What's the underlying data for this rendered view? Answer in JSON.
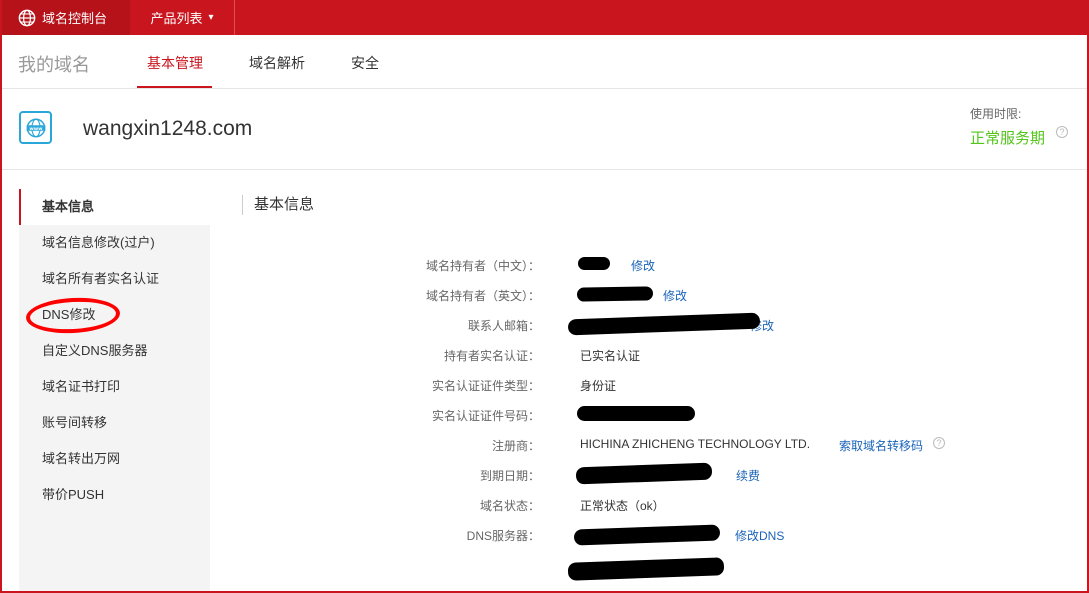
{
  "topbar": {
    "brand_label": "域名控制台",
    "menu_label": "产品列表",
    "menu_caret": "▾"
  },
  "nav": {
    "title": "我的域名",
    "tabs": [
      {
        "label": "基本管理",
        "active": true
      },
      {
        "label": "域名解析",
        "active": false
      },
      {
        "label": "安全",
        "active": false
      }
    ]
  },
  "domain": {
    "name": "wangxin1248.com",
    "usage_label": "使用时限:",
    "usage_status": "正常服务期"
  },
  "sidebar": {
    "items": [
      {
        "label": "基本信息",
        "active": true
      },
      {
        "label": "域名信息修改(过户)"
      },
      {
        "label": "域名所有者实名认证"
      },
      {
        "label": "DNS修改"
      },
      {
        "label": "自定义DNS服务器"
      },
      {
        "label": "域名证书打印"
      },
      {
        "label": "账号间转移"
      },
      {
        "label": "域名转出万网"
      },
      {
        "label": "带价PUSH"
      }
    ]
  },
  "content": {
    "title": "基本信息",
    "rows": [
      {
        "label": "域名持有者（中文）：",
        "value": "",
        "link": "修改"
      },
      {
        "label": "域名持有者（英文）：",
        "value": "",
        "link": "修改"
      },
      {
        "label": "联系人邮箱：",
        "value": "",
        "link": "修改"
      },
      {
        "label": "持有者实名认证：",
        "value": "已实名认证",
        "link": ""
      },
      {
        "label": "实名认证证件类型：",
        "value": "身份证",
        "link": ""
      },
      {
        "label": "实名认证证件号码：",
        "value": "",
        "link": ""
      },
      {
        "label": "注册商：",
        "value": "HICHINA ZHICHENG TECHNOLOGY LTD.",
        "link": "索取域名转移码"
      },
      {
        "label": "到期日期：",
        "value": "",
        "link": "续费"
      },
      {
        "label": "域名状态：",
        "value": "正常状态（ok）",
        "link": ""
      },
      {
        "label": "DNS服务器：",
        "value": "",
        "link": "修改DNS"
      }
    ]
  },
  "colors": {
    "brand_red": "#c9151e",
    "success_green": "#52c41a",
    "link_blue": "#1a63b8"
  },
  "icons": {
    "brand": "globe-icon",
    "domain": "www-globe-icon",
    "help": "question-circle-icon"
  }
}
